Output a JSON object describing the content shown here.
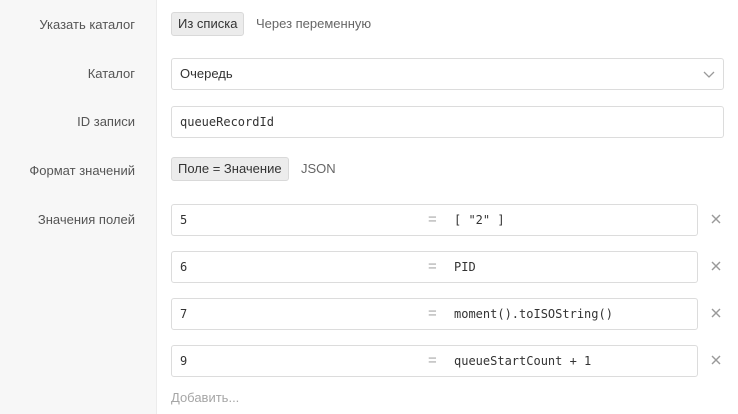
{
  "catalog_source": {
    "label": "Указать каталог",
    "options": [
      "Из списка",
      "Через переменную"
    ],
    "selected": "Из списка"
  },
  "catalog": {
    "label": "Каталог",
    "value": "Очередь",
    "icon": "chevron-down-icon"
  },
  "record_id": {
    "label": "ID записи",
    "value": "queueRecordId"
  },
  "value_format": {
    "label": "Формат значений",
    "options": [
      "Поле = Значение",
      "JSON"
    ],
    "selected": "Поле = Значение"
  },
  "field_values": {
    "label": "Значения полей",
    "separator": "=",
    "rows": [
      {
        "key": "5",
        "value": "[ \"2\" ]"
      },
      {
        "key": "6",
        "value": "PID"
      },
      {
        "key": "7",
        "value": "moment().toISOString()"
      },
      {
        "key": "9",
        "value": "queueStartCount + 1"
      }
    ],
    "remove_icon": "close-icon",
    "add_label": "Добавить..."
  }
}
